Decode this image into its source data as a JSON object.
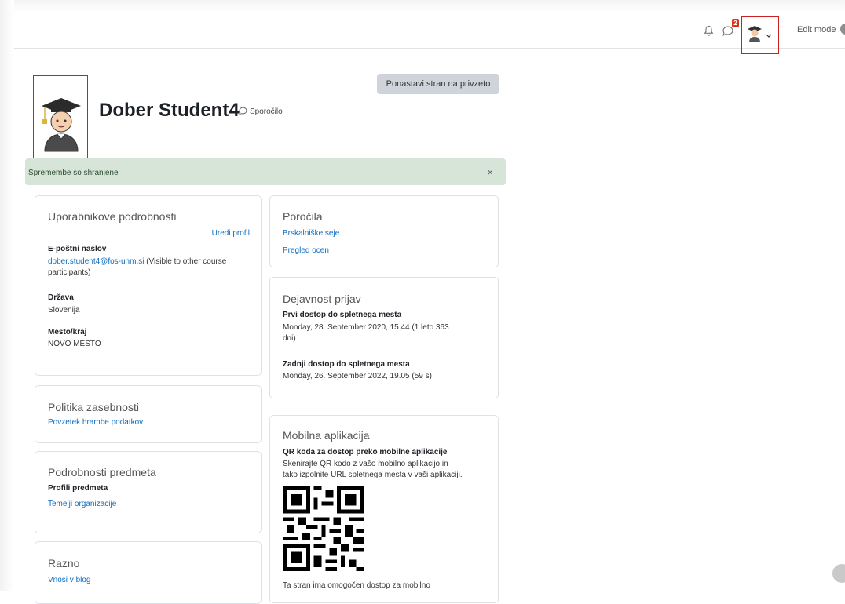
{
  "header": {
    "edit_mode_label": "Edit mode",
    "messages_badge": "2"
  },
  "profile": {
    "name": "Dober Student4",
    "message_label": "Sporočilo",
    "reset_button": "Ponastavi stran na privzeto"
  },
  "alert": {
    "text": "Spremembe so shranjene",
    "close": "×"
  },
  "user_details": {
    "title": "Uporabnikove podrobnosti",
    "edit_link": "Uredi profil",
    "email_label": "E-poštni naslov",
    "email_value": "dober.student4@fos-unm.si",
    "email_visibility_line1": " (Visible to other course",
    "email_visibility_line2": "participants)",
    "country_label": "Država",
    "country_value": "Slovenija",
    "city_label": "Mesto/kraj",
    "city_value": "NOVO MESTO"
  },
  "privacy": {
    "title": "Politika zasebnosti",
    "link": "Povzetek hrambe podatkov"
  },
  "course_details": {
    "title": "Podrobnosti predmeta",
    "profiles_label": "Profili predmeta",
    "course_link": "Temelji organizacije"
  },
  "misc": {
    "title": "Razno",
    "blog_link": "Vnosi v blog"
  },
  "reports": {
    "title": "Poročila",
    "browser_sessions": "Brskalniške seje",
    "grades_overview": "Pregled ocen"
  },
  "login_activity": {
    "title": "Dejavnost prijav",
    "first_access_label": "Prvi dostop do spletnega mesta",
    "first_access_line1": "Monday, 28. September 2020, 15.44  (1 leto 363",
    "first_access_line2": "dni)",
    "last_access_label": "Zadnji dostop do spletnega mesta",
    "last_access_value": "Monday, 26. September 2022, 19.05  (59 s)"
  },
  "mobile_app": {
    "title": "Mobilna aplikacija",
    "qr_label": "QR koda za dostop preko mobilne aplikacije",
    "qr_desc_line1": "Skenirajte QR kodo z vašo mobilno aplikacijo in",
    "qr_desc_line2": "tako izpolnite URL spletnega mesta v vaši aplikaciji.",
    "footer_text": "Ta stran ima omogočen dostop za mobilno"
  },
  "colors": {
    "link": "#0f6cbf",
    "alert_bg": "#d7e5d9",
    "highlight_box": "#cc1f1f",
    "badge": "#d9331a"
  },
  "icons": [
    "bell-icon",
    "chat-icon",
    "avatar-icon",
    "chevron-down-icon",
    "speech-bubble-icon",
    "close-icon",
    "qr-code-icon"
  ]
}
